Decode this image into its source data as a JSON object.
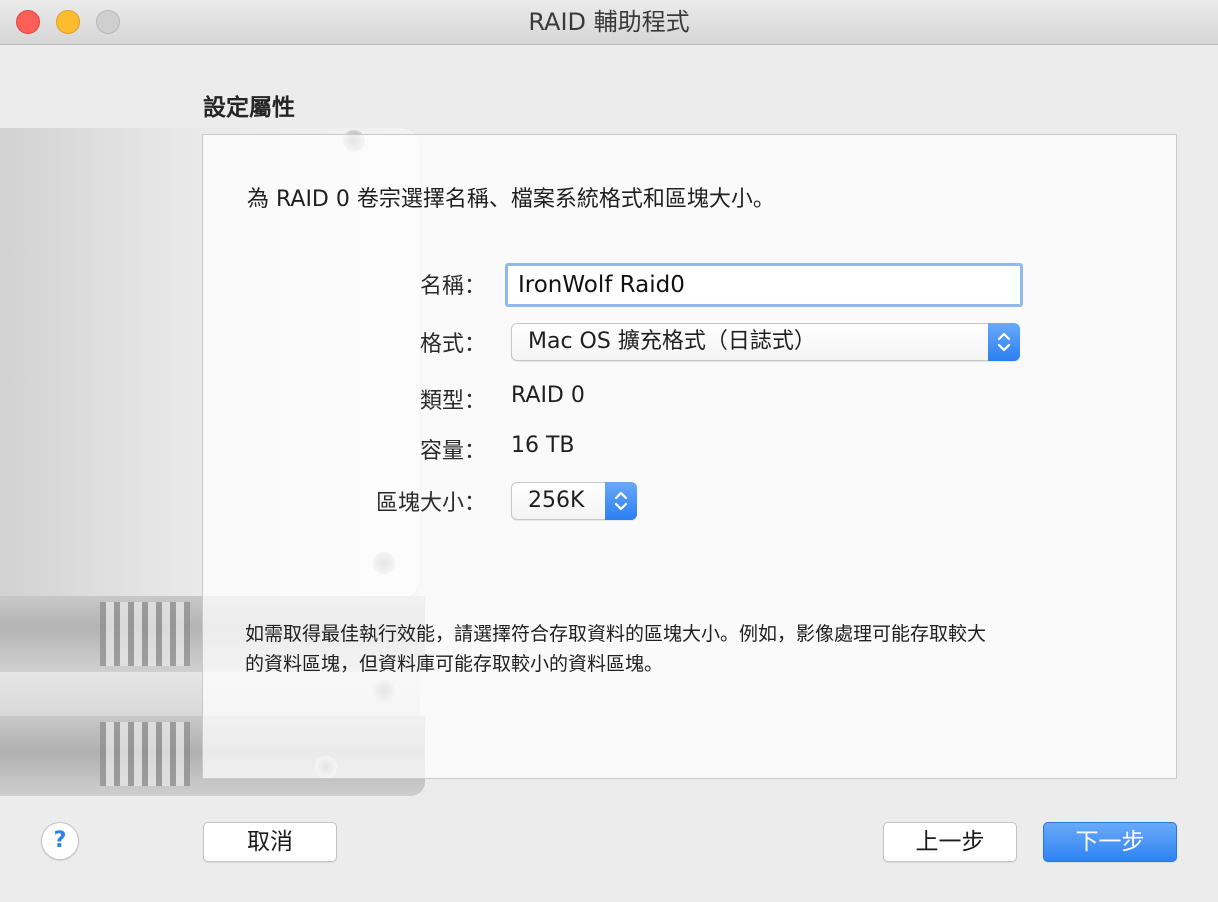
{
  "window": {
    "title": "RAID 輔助程式"
  },
  "section": {
    "title": "設定屬性"
  },
  "panel": {
    "intro": "為 RAID 0 卷宗選擇名稱、檔案系統格式和區塊大小。",
    "name_label": "名稱：",
    "name_value": "IronWolf Raid0",
    "format_label": "格式：",
    "format_value": "Mac OS 擴充格式（日誌式）",
    "type_label": "類型：",
    "type_value": "RAID 0",
    "capacity_label": "容量：",
    "capacity_value": "16 TB",
    "chunk_label": "區塊大小：",
    "chunk_value": "256K",
    "hint_line1": "如需取得最佳執行效能，請選擇符合存取資料的區塊大小。例如，影像處理可能存取較大",
    "hint_line2": "的資料區塊，但資料庫可能存取較小的資料區塊。"
  },
  "buttons": {
    "help": "?",
    "cancel": "取消",
    "back": "上一步",
    "next": "下一步"
  },
  "colors": {
    "accent": "#2f83f4",
    "focus_ring": "#8fb8ec"
  }
}
